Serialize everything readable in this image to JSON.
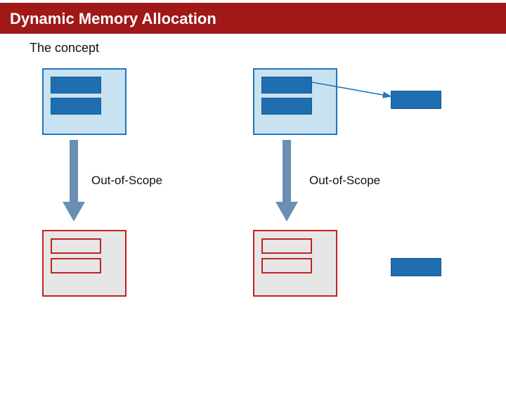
{
  "title": "Dynamic Memory Allocation",
  "subtitle": "The concept",
  "labels": {
    "oos_left": "Out-of-Scope",
    "oos_right": "Out-of-Scope"
  }
}
